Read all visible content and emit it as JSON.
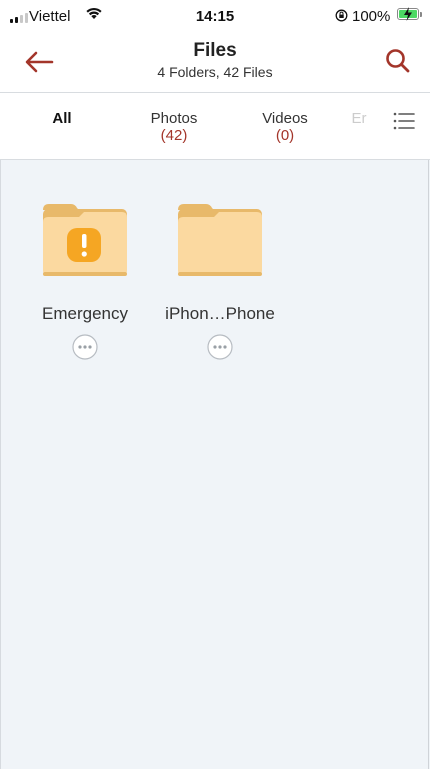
{
  "status_bar": {
    "carrier": "Viettel",
    "time": "14:15",
    "battery_percent": "100%",
    "signal_bars_filled": 2,
    "charging": true
  },
  "header": {
    "title": "Files",
    "subtitle": "4 Folders, 42 Files",
    "back_icon": "arrow-left-icon",
    "search_icon": "search-icon"
  },
  "tabs": [
    {
      "label": "All",
      "count": ""
    },
    {
      "label": "Photos",
      "count": "(42)"
    },
    {
      "label": "Videos",
      "count": "(0)"
    },
    {
      "label": "Er",
      "count": ""
    }
  ],
  "list_icon": "list-icon",
  "folders": [
    {
      "name": "Emergency",
      "icon": "folder-warning-icon"
    },
    {
      "name": "iPhon…Phone",
      "icon": "folder-icon"
    }
  ],
  "colors": {
    "accent": "#a3352a",
    "background": "#f0f4f8",
    "folder_body": "#fbd9a0",
    "folder_tab": "#e8b96a",
    "warning": "#f5a623"
  }
}
